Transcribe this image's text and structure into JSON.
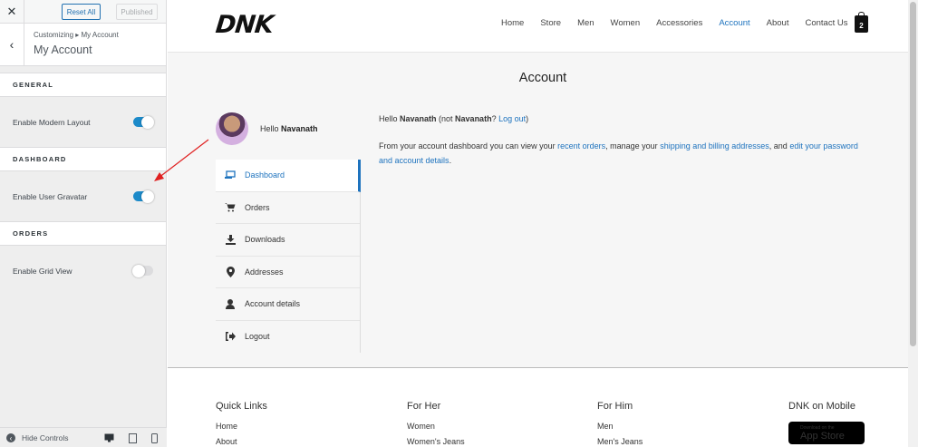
{
  "customizer": {
    "close_label": "✕",
    "reset_label": "Reset All",
    "published_label": "Published",
    "breadcrumb": "Customizing ▸ My Account",
    "panel_title": "My Account",
    "sections": [
      {
        "label": "GENERAL",
        "controls": [
          {
            "label": "Enable Modern Layout",
            "on": true
          }
        ]
      },
      {
        "label": "DASHBOARD",
        "controls": [
          {
            "label": "Enable User Gravatar",
            "on": true
          }
        ]
      },
      {
        "label": "ORDERS",
        "controls": [
          {
            "label": "Enable Grid View",
            "on": false
          }
        ]
      }
    ],
    "hide_controls_label": "Hide Controls"
  },
  "site": {
    "logo": "DNK",
    "nav": [
      "Home",
      "Store",
      "Men",
      "Women",
      "Accessories",
      "Account",
      "About",
      "Contact Us"
    ],
    "active_nav": "Account",
    "cart_count": "2",
    "page_title": "Account",
    "greeting_prefix": "Hello ",
    "user_name": "Navanath",
    "account_nav": [
      "Dashboard",
      "Orders",
      "Downloads",
      "Addresses",
      "Account details",
      "Logout"
    ],
    "content": {
      "hello": "Hello ",
      "name": "Navanath",
      "not_text": " (not ",
      "name2": "Navanath",
      "q": "? ",
      "logout": "Log out",
      "close": ")",
      "intro": "From your account dashboard you can view your ",
      "recent_orders": "recent orders",
      "comma": ", manage your ",
      "addresses": "shipping and billing addresses",
      "and": ", and ",
      "edit": "edit your password and account details",
      "period": "."
    },
    "footer": {
      "quick_links": {
        "title": "Quick Links",
        "items": [
          "Home",
          "About"
        ]
      },
      "for_her": {
        "title": "For Her",
        "items": [
          "Women",
          "Women's Jeans"
        ]
      },
      "for_him": {
        "title": "For Him",
        "items": [
          "Men",
          "Men's Jeans"
        ]
      },
      "mobile": {
        "title": "DNK on Mobile",
        "badge_small": "Download on the",
        "badge_big": "App Store"
      }
    }
  }
}
